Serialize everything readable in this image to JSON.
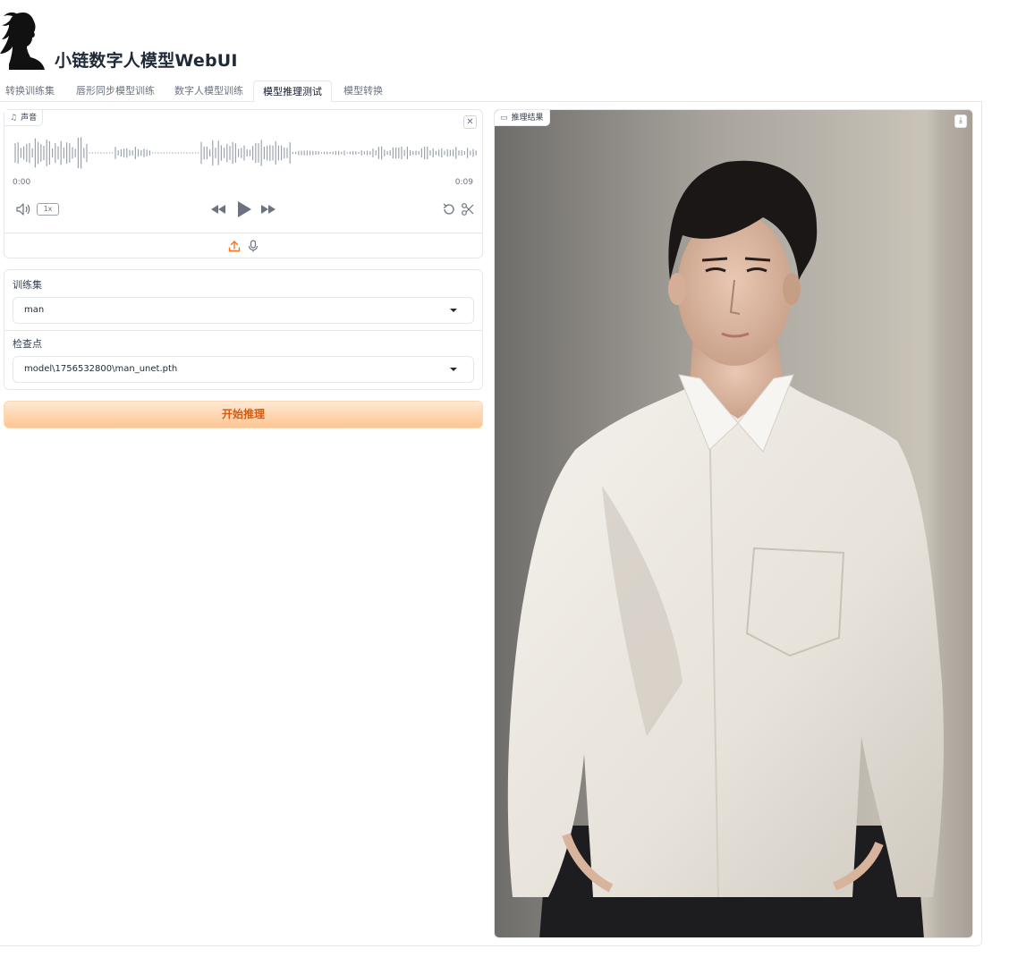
{
  "app": {
    "title": "小链数字人模型WebUI"
  },
  "tabs": [
    {
      "label": "转换训练集"
    },
    {
      "label": "唇形同步模型训练"
    },
    {
      "label": "数字人模型训练"
    },
    {
      "label": "模型推理测试"
    },
    {
      "label": "模型转换"
    }
  ],
  "active_tab": "模型推理测试",
  "audio": {
    "label": "声音",
    "icon": "music-note-icon",
    "current_time": "0:00",
    "duration": "0:09",
    "playback_speed": "1x",
    "progress": 0.0
  },
  "dataset": {
    "label": "训练集",
    "value": "man"
  },
  "checkpoint": {
    "label": "检查点",
    "value": "model\\1756532800\\man_unet.pth"
  },
  "run_button": {
    "label": "开始推理"
  },
  "result": {
    "label": "推理结果",
    "icon": "video-icon"
  },
  "colors": {
    "accent": "#f97316",
    "button_text": "#d65a12",
    "border": "#e5e7eb"
  }
}
